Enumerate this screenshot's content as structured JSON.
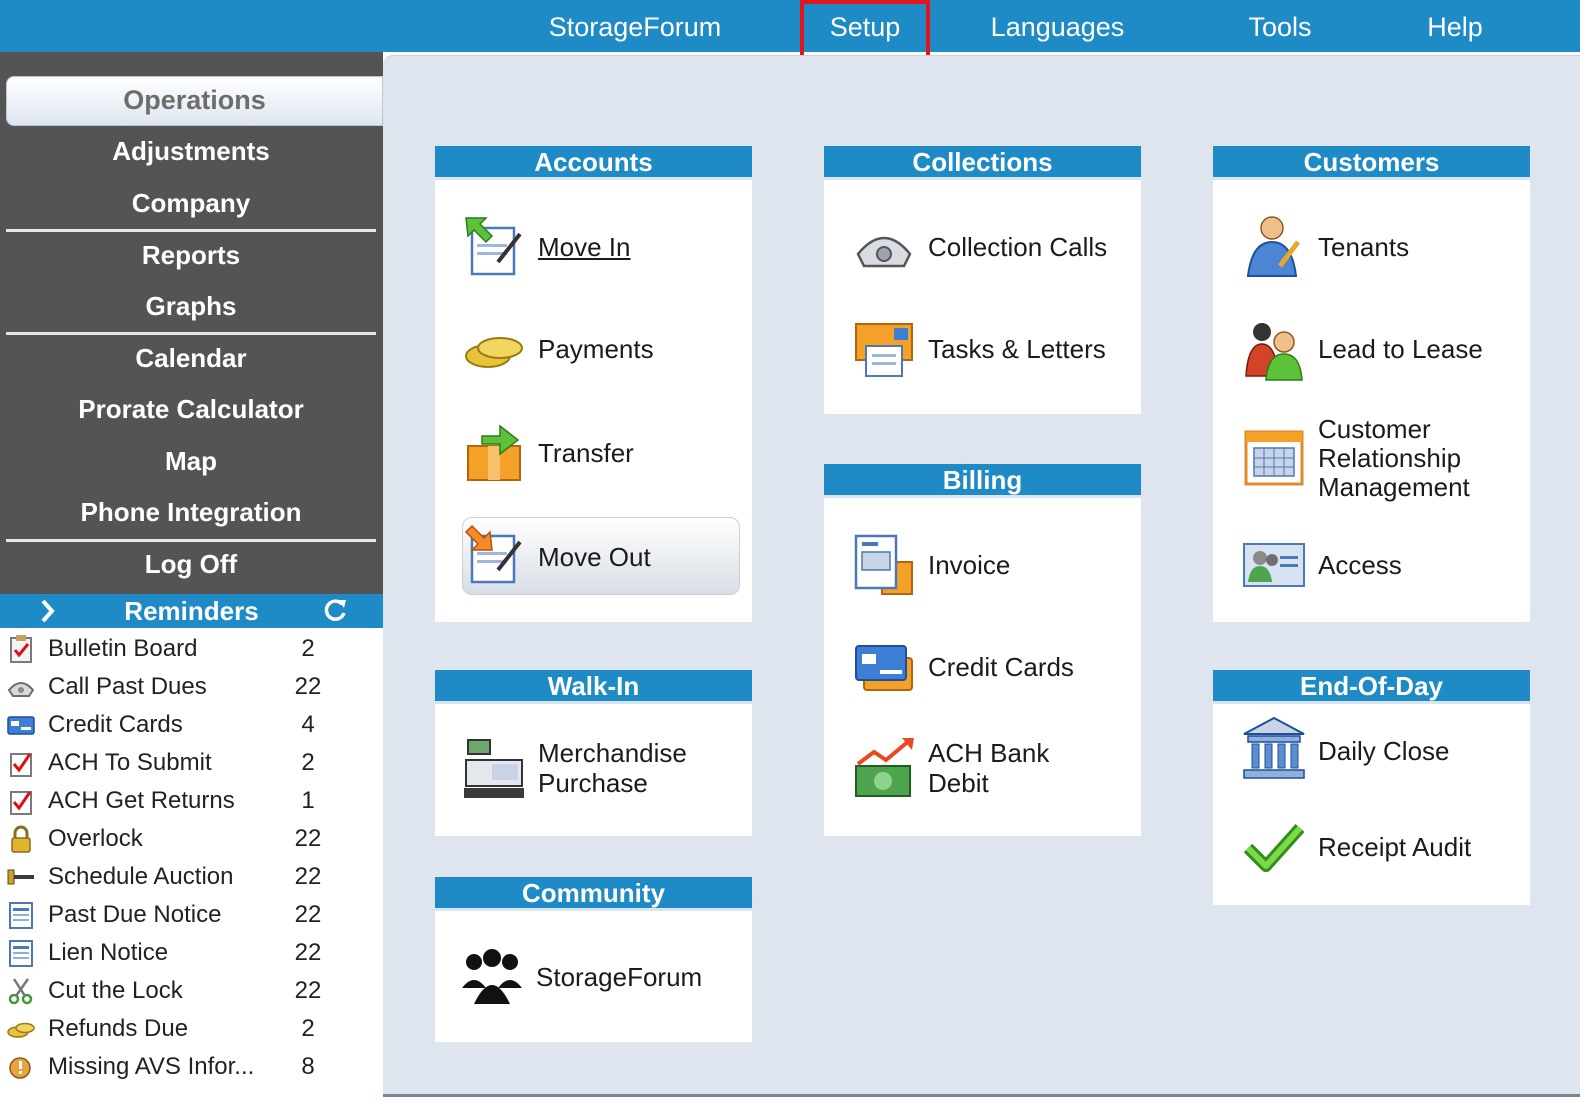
{
  "menubar": {
    "items": [
      "StorageForum",
      "Setup",
      "Languages",
      "Tools",
      "Help"
    ]
  },
  "sidebar": {
    "active": "Operations",
    "items": [
      "Adjustments",
      "Company",
      "Reports",
      "Graphs",
      "Calendar",
      "Prorate Calculator",
      "Map",
      "Phone Integration",
      "Log Off"
    ]
  },
  "reminders": {
    "title": "Reminders",
    "rows": [
      {
        "label": "Bulletin Board",
        "count": "2",
        "icon": "clipboard-check-icon"
      },
      {
        "label": "Call Past Dues",
        "count": "22",
        "icon": "phone-icon"
      },
      {
        "label": "Credit Cards",
        "count": "4",
        "icon": "credit-card-icon"
      },
      {
        "label": "ACH To Submit",
        "count": "2",
        "icon": "checklist-icon"
      },
      {
        "label": "ACH Get Returns",
        "count": "1",
        "icon": "checklist-icon"
      },
      {
        "label": "Overlock",
        "count": "22",
        "icon": "padlock-icon"
      },
      {
        "label": "Schedule Auction",
        "count": "22",
        "icon": "gavel-icon"
      },
      {
        "label": "Past Due Notice",
        "count": "22",
        "icon": "document-icon"
      },
      {
        "label": "Lien Notice",
        "count": "22",
        "icon": "document-icon"
      },
      {
        "label": "Cut the Lock",
        "count": "22",
        "icon": "scissors-icon"
      },
      {
        "label": "Refunds Due",
        "count": "2",
        "icon": "coins-icon"
      },
      {
        "label": "Missing AVS Infor...",
        "count": "8",
        "icon": "warning-icon"
      }
    ]
  },
  "panels": {
    "accounts": {
      "title": "Accounts",
      "items": [
        "Move In",
        "Payments",
        "Transfer",
        "Move Out"
      ]
    },
    "walkin": {
      "title": "Walk-In",
      "items": [
        "Merchandise",
        "Purchase"
      ]
    },
    "community": {
      "title": "Community",
      "items": [
        "StorageForum"
      ]
    },
    "collections": {
      "title": "Collections",
      "items": [
        "Collection Calls",
        "Tasks & Letters"
      ]
    },
    "billing": {
      "title": "Billing",
      "items": [
        "Invoice",
        "Credit Cards",
        "ACH Bank",
        "Debit"
      ]
    },
    "customers": {
      "title": "Customers",
      "items": [
        "Tenants",
        "Lead to Lease",
        "Customer",
        "Relationship",
        "Management",
        "Access"
      ]
    },
    "endofday": {
      "title": "End-Of-Day",
      "items": [
        "Daily Close",
        "Receipt Audit"
      ]
    }
  },
  "colors": {
    "accent": "#1f8bc6",
    "sidebar": "#545454",
    "highlight": "#e3141b",
    "background": "#dfe5ee"
  }
}
